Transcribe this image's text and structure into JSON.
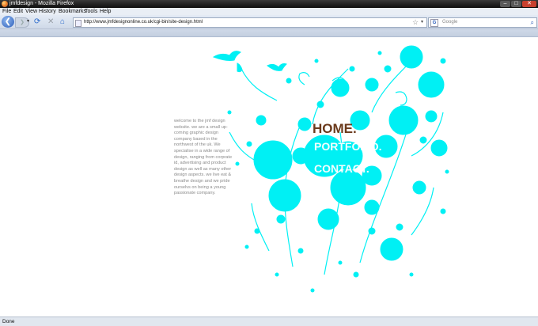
{
  "window": {
    "title": "jmfdesign - Mozilla Firefox",
    "minimize": "–",
    "maximize": "□",
    "close": "✕"
  },
  "menu": [
    "File",
    "Edit",
    "View",
    "History",
    "Bookmarks",
    "Tools",
    "Help"
  ],
  "toolbar": {
    "back": "❮",
    "forward": "❯",
    "history_dropdown": "▾",
    "reload": "⟳",
    "stop": "✕",
    "home": "⌂"
  },
  "address": {
    "url": "http://www.jmfdesignonline.co.uk/cgi-bin/site-design.html",
    "star": "☆",
    "dropdown": "▾"
  },
  "search": {
    "engine": "G",
    "placeholder": "Google",
    "go": "⌕"
  },
  "page": {
    "intro": "welcome to the jmf design website. we are a small up-coming graphic design company based in the northwest of the uk. We specialise in a wide range of design, ranging from corprate id, advertising and product design as well as many other design aspects. we live eat & breathe design and we pride ourselvs on being a young passionate company.",
    "nav_home": "HOME.",
    "nav_portfolio": "PORTFOLIO.",
    "nav_contact": "CONTACT.",
    "splash_color": "#00f0f4",
    "home_color": "#6b3a1c"
  },
  "status": {
    "text": "Done"
  }
}
